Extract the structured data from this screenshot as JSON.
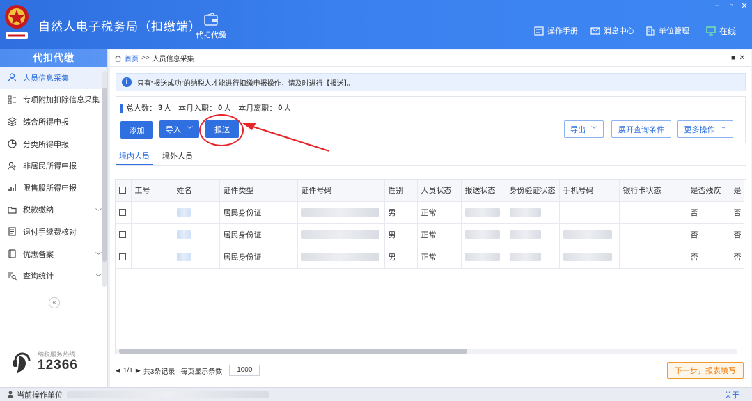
{
  "app": {
    "title": "自然人电子税务局（扣缴端）",
    "module_label": "代扣代缴"
  },
  "toolbar": {
    "manual": "操作手册",
    "messages": "消息中心",
    "unit_mgmt": "单位管理",
    "online": "在线"
  },
  "sidebar": {
    "header": "代扣代缴",
    "items": [
      {
        "label": "人员信息采集",
        "icon": "person-icon"
      },
      {
        "label": "专项附加扣除信息采集",
        "icon": "list-icon"
      },
      {
        "label": "综合所得申报",
        "icon": "layers-icon"
      },
      {
        "label": "分类所得申报",
        "icon": "pie-icon"
      },
      {
        "label": "非居民所得申报",
        "icon": "user-icon"
      },
      {
        "label": "限售股所得申报",
        "icon": "bar-chart-icon"
      },
      {
        "label": "税款缴纳",
        "icon": "folder-icon"
      },
      {
        "label": "退付手续费核对",
        "icon": "doc-icon"
      },
      {
        "label": "优惠备案",
        "icon": "book-icon"
      },
      {
        "label": "查询统计",
        "icon": "search-list-icon"
      }
    ],
    "hotline_label": "纳税服务热线",
    "hotline_number": "12366"
  },
  "breadcrumb": {
    "home": "首页",
    "sep": ">>",
    "current": "人员信息采集"
  },
  "notice": "只有“报送成功”的纳税人才能进行扣缴申报操作，请及时进行【报送】。",
  "stats": {
    "total_label": "总人数：",
    "total": "3",
    "unit": "人",
    "joined_label": "本月入职：",
    "joined": "0",
    "left_label": "本月离职：",
    "left": "0"
  },
  "buttons": {
    "add": "添加",
    "import": "导入",
    "submit": "报送",
    "export": "导出",
    "expand_query": "展开查询条件",
    "more": "更多操作"
  },
  "tabs": [
    "境内人员",
    "境外人员"
  ],
  "table": {
    "columns": [
      "工号",
      "姓名",
      "证件类型",
      "证件号码",
      "性别",
      "人员状态",
      "报送状态",
      "身份验证状态",
      "手机号码",
      "银行卡状态",
      "是否残疾",
      "是"
    ],
    "rows": [
      {
        "id_type": "居民身份证",
        "gender": "男",
        "status": "正常",
        "disabled": "否",
        "extra": "否"
      },
      {
        "id_type": "居民身份证",
        "gender": "男",
        "status": "正常",
        "disabled": "否",
        "extra": "否"
      },
      {
        "id_type": "居民身份证",
        "gender": "男",
        "status": "正常",
        "disabled": "否",
        "extra": "否"
      }
    ]
  },
  "pagination": {
    "page": "1/1",
    "records": "共3条记录",
    "per_page_label": "每页显示条数",
    "per_page": "1000"
  },
  "next_button": "下一步，报表填写",
  "statusbar": {
    "unit_label": "当前操作单位",
    "about": "关于"
  },
  "colors": {
    "primary": "#2f6fe0",
    "annotation": "#e5262b",
    "next": "#f07e0e"
  }
}
